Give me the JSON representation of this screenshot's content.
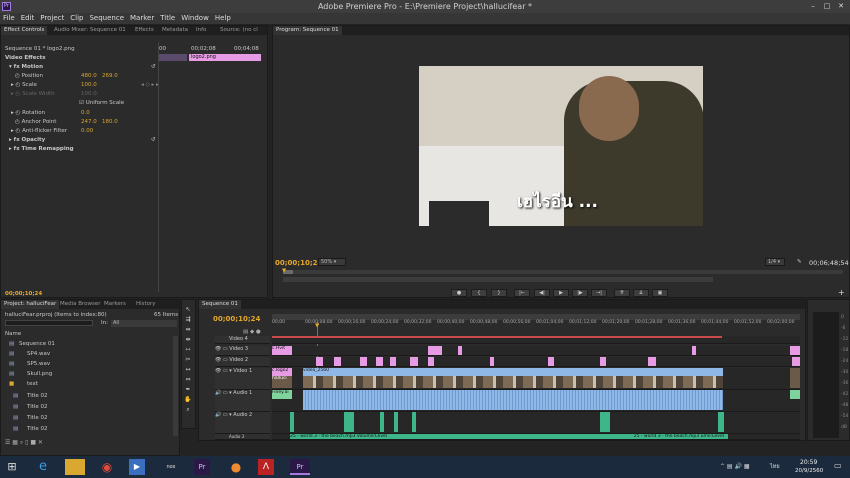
{
  "window": {
    "title": "Adobe Premiere Pro - E:\\Premiere Project\\hallucifear *"
  },
  "menu": [
    "File",
    "Edit",
    "Project",
    "Clip",
    "Sequence",
    "Marker",
    "Title",
    "Window",
    "Help"
  ],
  "effect_controls": {
    "tabs": [
      "Effect Controls",
      "Audio Mixer: Sequence 01",
      "Effects",
      "Metadata",
      "Info",
      "Source: (no cl"
    ],
    "clip_label": "Sequence 01 * logo2.png",
    "ruler": [
      "00",
      "00;02;08",
      "00;04;08"
    ],
    "clip_name": "logo2.png",
    "section": "Video Effects",
    "motion": "Motion",
    "position_label": "Position",
    "position_x": "480.0",
    "position_y": "269.0",
    "scale_label": "Scale",
    "scale_val": "100.0",
    "scale_width_label": "Scale Width",
    "scale_width_val": "100.0",
    "uniform_scale": "Uniform Scale",
    "rotation_label": "Rotation",
    "rotation_val": "0.0",
    "anchor_label": "Anchor Point",
    "anchor_x": "247.0",
    "anchor_y": "180.0",
    "antiflicker_label": "Anti-flicker Filter",
    "antiflicker_val": "0.00",
    "opacity": "Opacity",
    "time_remap": "Time Remapping",
    "timecode": "00;00;10;24"
  },
  "program": {
    "tab": "Program: Sequence 01",
    "overlay_text": "เฮไรอีน ...",
    "timecode": "00;00;10;24",
    "zoom": "50%",
    "resolution": "1/4",
    "duration": "00;06;48;54"
  },
  "project": {
    "tabs": [
      "Project: halluciFear",
      "Media Browser",
      "Markers",
      "History"
    ],
    "file_line": "halluciFear.prproj (Items to index:80)",
    "item_count": "65 Items",
    "in_label": "In:",
    "in_value": "All",
    "name_col": "Name",
    "items": [
      "Sequence 01",
      "SP4.wav",
      "SP5.wav",
      "Skull.png",
      "text",
      "Title 02",
      "Title 02",
      "Title 02",
      "Title 02"
    ]
  },
  "timeline": {
    "tab": "Sequence 01",
    "timecode": "00;00;10;24",
    "ruler": [
      "00;00",
      "00;00;08;00",
      "00;00;16;00",
      "00;00;24;00",
      "00;00;32;00",
      "00;00;40;00",
      "00;00;48;00",
      "00;00;56;00",
      "00;01;04;00",
      "00;01;12;00",
      "00;01;20;00",
      "00;01;28;00",
      "00;01;36;00",
      "00;01;44;00",
      "00;01;52;00",
      "00;02;00;00"
    ],
    "tracks": [
      "Video 4",
      "Video 3",
      "Video 2",
      "Video 1",
      "Audio 1",
      "Audio 2",
      "Audio 3"
    ],
    "clip_labels": {
      "v2_a": "c.Hvit",
      "v1_a": "c.logo2",
      "v1_b": "halluci",
      "a1_a": "Finey.ai",
      "video_clip": "video_2560",
      "a3_a": "25 - world 3 - the beach.mp3 Volume:Level",
      "a3_b": "25 - world 3 - the beach.mp3 ume:Level"
    }
  },
  "taskbar": {
    "clock_time": "20:59",
    "clock_date": "20/9/2560",
    "lang": "ไทย",
    "nox": "nox"
  },
  "colors": {
    "accent_timecode": "#e6a92a",
    "clip_pink": "#e79be5",
    "clip_blue": "#8fb8e6",
    "clip_green": "#3fb58a"
  }
}
